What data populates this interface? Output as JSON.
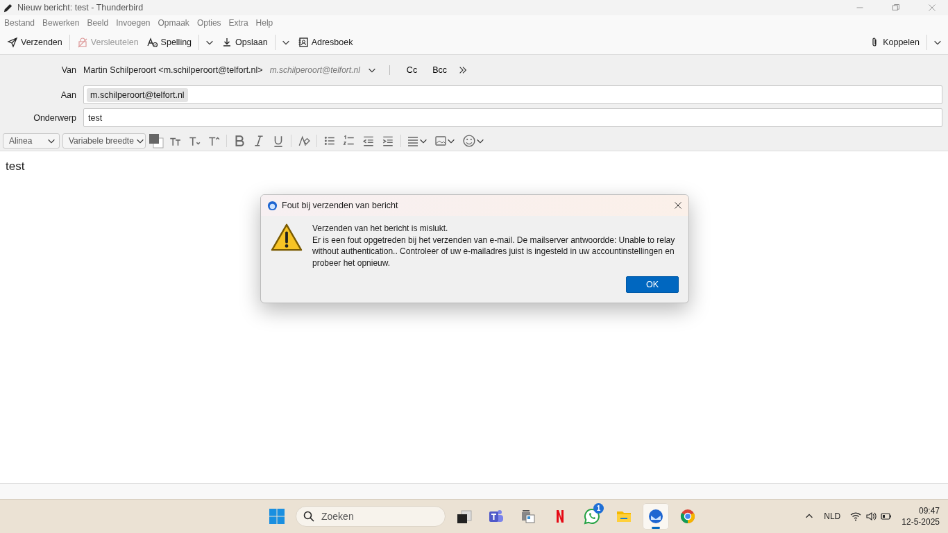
{
  "window": {
    "title": "Nieuw bericht: test - Thunderbird"
  },
  "menu": [
    "Bestand",
    "Bewerken",
    "Beeld",
    "Invoegen",
    "Opmaak",
    "Opties",
    "Extra",
    "Help"
  ],
  "toolbar": [
    {
      "kind": "button",
      "label": "Verzenden",
      "disabled": false
    },
    {
      "kind": "button",
      "label": "Versleutelen",
      "disabled": true
    },
    {
      "kind": "split",
      "label": "Spelling",
      "disabled": false
    },
    {
      "kind": "split",
      "label": "Opslaan",
      "disabled": false
    },
    {
      "kind": "button",
      "label": "Adresboek",
      "disabled": false
    }
  ],
  "attach": {
    "label": "Koppelen"
  },
  "header": {
    "from_label": "Van",
    "from": "Martin Schilperoort <m.schilperoort@telfort.nl>",
    "from_hint": "m.schilperoort@telfort.nl",
    "cc": "Cc",
    "bcc": "Bcc",
    "to_label": "Aan",
    "to": [
      "m.schilperoort@telfort.nl"
    ],
    "subject_label": "Onderwerp",
    "subject": "test"
  },
  "format": {
    "paragraph": "Alinea",
    "font": "Variabele breedte"
  },
  "body": "test",
  "dialog": {
    "title": "Fout bij verzenden van bericht",
    "heading": "Verzenden van het bericht is mislukt.",
    "message": "Er is een fout opgetreden bij het verzenden van e-mail. De mailserver antwoordde: Unable to relay without authentication.. Controleer of uw e-mailadres juist is ingesteld in uw accountinstellingen en probeer het opnieuw.",
    "ok": "OK"
  },
  "taskbar": {
    "search": "Zoeken",
    "apps": [
      {
        "kind": "taskview",
        "selected": false
      },
      {
        "kind": "teams",
        "selected": false
      },
      {
        "kind": "scanner",
        "selected": false
      },
      {
        "kind": "netflix",
        "selected": false
      },
      {
        "kind": "whatsapp",
        "selected": false,
        "badge": "1"
      },
      {
        "kind": "files",
        "selected": false
      },
      {
        "kind": "thunderbird",
        "selected": true
      },
      {
        "kind": "chrome",
        "selected": false
      }
    ],
    "language": "NLD",
    "time": "09:47",
    "date": "12-5-2025"
  }
}
